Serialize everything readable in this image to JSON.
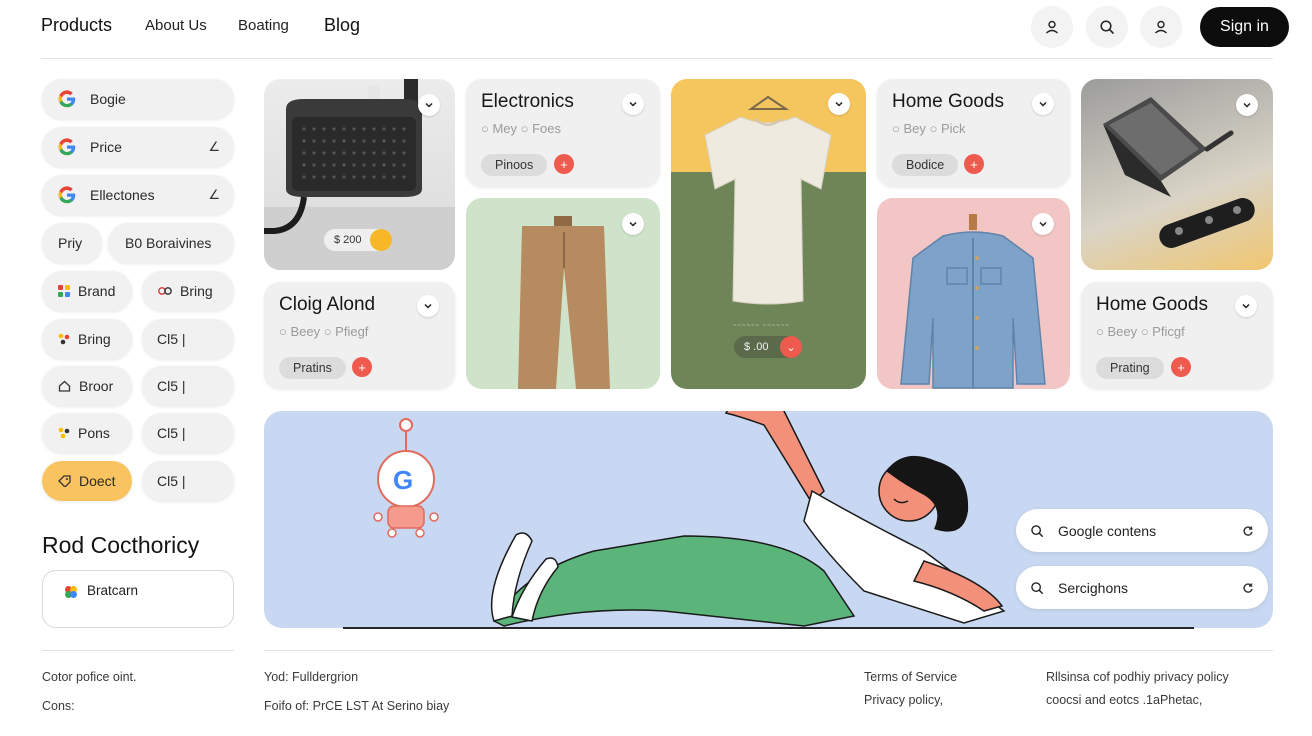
{
  "header": {
    "nav": [
      "Products",
      "About Us",
      "Boating",
      "Blog"
    ],
    "sign_in": "Sign in",
    "icons": [
      "user-icon",
      "search-icon",
      "user-icon"
    ]
  },
  "sidebar": {
    "filters": [
      {
        "label": "Bogie",
        "icon": "google-icon"
      },
      {
        "label": "Price",
        "icon": "google-icon",
        "edit": "∠"
      },
      {
        "label": "Ellectones",
        "icon": "google-icon",
        "edit": "∠"
      }
    ],
    "row_pills": [
      [
        "Priy",
        "B0  Boraivines"
      ],
      [
        "Brand",
        "Bring"
      ],
      [
        "Bring",
        "Cl5  |"
      ],
      [
        "Broor",
        "Cl5  |"
      ],
      [
        "Pons",
        "Cl5  |"
      ],
      [
        "Doect",
        "Cl5  |"
      ]
    ],
    "heading": "Rod Cocthoricy",
    "card_label": "Bratcarn"
  },
  "products": {
    "card1_price": "$ 200",
    "electronics": {
      "title": "Electronics",
      "sub": "○ Mey ○ Foes",
      "tag": "Pinoos"
    },
    "tshirt_price": "$ .00",
    "tshirt_caption": "~~~~~~ ~~~~~~",
    "home1": {
      "title": "Home Goods",
      "sub": "○ Bey ○ Pick",
      "tag": "Bodice"
    },
    "clothing": {
      "title": "Cloig Alond",
      "sub": "○ Beey ○ Pfiegf",
      "tag": "Pratins"
    },
    "home2": {
      "title": "Home Goods",
      "sub": "○ Beey ○ Pficgf",
      "tag": "Prating"
    }
  },
  "hero": {
    "search1": "Google contens",
    "search2": "Sercighons"
  },
  "footer": {
    "left1": "Cotor pofice oint.",
    "left2": "Cons:",
    "mid1": "Yod: Fulldergrion",
    "mid2": "Foifo of: PrCE LST At Serino biay",
    "terms": "Terms of Service",
    "privacy": "Privacy policy,",
    "right1": "Rllsinsa cof podhiy privacy policy",
    "right2": "coocsi and eotcs .1aPhetac,"
  },
  "colors": {
    "accent_yellow": "#f9c45f",
    "plus_red": "#ee5a4e",
    "hero_blue": "#c9d8f2",
    "signin_black": "#0c0c0c"
  }
}
